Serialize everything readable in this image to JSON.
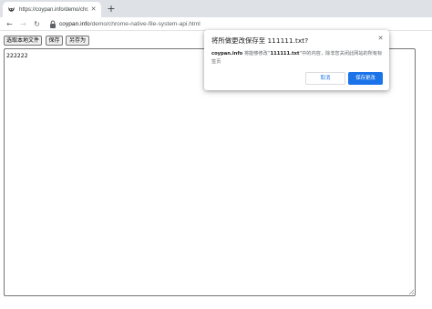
{
  "browser": {
    "tab": {
      "title": "https://coypan.info/demo/chr...",
      "close_glyph": "✕"
    },
    "new_tab_glyph": "+",
    "nav": {
      "back_glyph": "←",
      "forward_glyph": "→",
      "reload_glyph": "↻"
    },
    "address_bar": {
      "domain": "coypan.info",
      "path": "/demo/chrome-native-file-system-api.html"
    }
  },
  "page": {
    "buttons": {
      "open_file": "选取本地文件",
      "save": "保存",
      "save_as": "另存为"
    },
    "editor_content": "222222"
  },
  "dialog": {
    "title": "将所做更改保存至 111111.txt?",
    "close_glyph": "✕",
    "site": "coypan.info",
    "msg_before": " 将能够修改“",
    "file_name": "111111.txt",
    "msg_after": "”中的内容，除非您关闭此网站的所有标签页",
    "cancel_label": "取消",
    "confirm_label": "保存更改"
  },
  "colors": {
    "accent": "#1a73e8",
    "tabstrip": "#dee1e6"
  },
  "icons": {
    "tab_favicon": "cat-favicon-icon",
    "lock": "lock-icon",
    "close": "close-icon",
    "resize_grip": "resize-grip-icon"
  }
}
